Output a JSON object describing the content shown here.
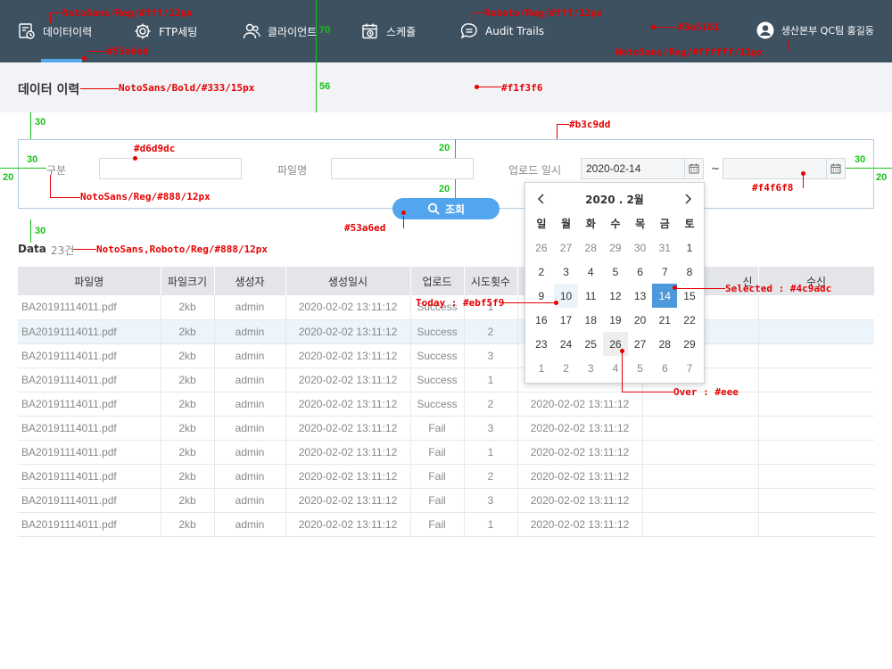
{
  "nav": {
    "items": [
      {
        "label": "데이터이력",
        "icon": "history-document-icon"
      },
      {
        "label": "FTP세팅",
        "icon": "gear-icon"
      },
      {
        "label": "클라이언트",
        "icon": "users-icon"
      },
      {
        "label": "스케쥴",
        "icon": "calendar-clock-icon"
      },
      {
        "label": "Audit Trails",
        "icon": "chat-list-icon"
      }
    ],
    "user": "생산본부 QC팀 홍길동"
  },
  "page": {
    "title": "데이터 이력"
  },
  "search": {
    "fields": [
      {
        "label": "구분",
        "value": ""
      },
      {
        "label": "파일명",
        "value": ""
      }
    ],
    "date_label": "업로드 일시",
    "date_from": "2020-02-14",
    "date_to": "",
    "date_sep": "~",
    "button": "조회"
  },
  "data": {
    "label": "Data",
    "count": "23건"
  },
  "table": {
    "columns": [
      "파일명",
      "파일크기",
      "생성자",
      "생성일시",
      "업로드",
      "시도횟수",
      "",
      "",
      "수신"
    ],
    "partial_header": "신",
    "rows": [
      [
        "BA20191114011.pdf",
        "2kb",
        "admin",
        "2020-02-02 13:11:12",
        "Success",
        "1",
        "",
        "",
        ""
      ],
      [
        "BA20191114011.pdf",
        "2kb",
        "admin",
        "2020-02-02 13:11:12",
        "Success",
        "2",
        "",
        "",
        ""
      ],
      [
        "BA20191114011.pdf",
        "2kb",
        "admin",
        "2020-02-02 13:11:12",
        "Success",
        "3",
        "",
        "",
        ""
      ],
      [
        "BA20191114011.pdf",
        "2kb",
        "admin",
        "2020-02-02 13:11:12",
        "Success",
        "1",
        "",
        "",
        ""
      ],
      [
        "BA20191114011.pdf",
        "2kb",
        "admin",
        "2020-02-02 13:11:12",
        "Success",
        "2",
        "2020-02-02 13:11:12",
        "",
        ""
      ],
      [
        "BA20191114011.pdf",
        "2kb",
        "admin",
        "2020-02-02 13:11:12",
        "Fail",
        "3",
        "2020-02-02 13:11:12",
        "",
        ""
      ],
      [
        "BA20191114011.pdf",
        "2kb",
        "admin",
        "2020-02-02 13:11:12",
        "Fail",
        "1",
        "2020-02-02 13:11:12",
        "",
        ""
      ],
      [
        "BA20191114011.pdf",
        "2kb",
        "admin",
        "2020-02-02 13:11:12",
        "Fail",
        "2",
        "2020-02-02 13:11:12",
        "",
        ""
      ],
      [
        "BA20191114011.pdf",
        "2kb",
        "admin",
        "2020-02-02 13:11:12",
        "Fail",
        "3",
        "2020-02-02 13:11:12",
        "",
        ""
      ],
      [
        "BA20191114011.pdf",
        "2kb",
        "admin",
        "2020-02-02 13:11:12",
        "Fail",
        "1",
        "2020-02-02 13:11:12",
        "",
        ""
      ]
    ],
    "highlight_row": 1
  },
  "calendar": {
    "title": "2020 . 2월",
    "weekdays": [
      "일",
      "월",
      "화",
      "수",
      "목",
      "금",
      "토"
    ],
    "weeks": [
      [
        [
          "26",
          "muted"
        ],
        [
          "27",
          "muted"
        ],
        [
          "28",
          "muted"
        ],
        [
          "29",
          "muted"
        ],
        [
          "30",
          "muted"
        ],
        [
          "31",
          "muted"
        ],
        [
          "1",
          ""
        ]
      ],
      [
        [
          "2",
          ""
        ],
        [
          "3",
          ""
        ],
        [
          "4",
          ""
        ],
        [
          "5",
          ""
        ],
        [
          "6",
          ""
        ],
        [
          "7",
          ""
        ],
        [
          "8",
          ""
        ]
      ],
      [
        [
          "9",
          ""
        ],
        [
          "10",
          "today"
        ],
        [
          "11",
          ""
        ],
        [
          "12",
          ""
        ],
        [
          "13",
          ""
        ],
        [
          "14",
          "sel"
        ],
        [
          "15",
          ""
        ]
      ],
      [
        [
          "16",
          ""
        ],
        [
          "17",
          ""
        ],
        [
          "18",
          ""
        ],
        [
          "19",
          ""
        ],
        [
          "20",
          ""
        ],
        [
          "21",
          ""
        ],
        [
          "22",
          ""
        ]
      ],
      [
        [
          "23",
          ""
        ],
        [
          "24",
          ""
        ],
        [
          "25",
          ""
        ],
        [
          "26",
          "over"
        ],
        [
          "27",
          ""
        ],
        [
          "28",
          ""
        ],
        [
          "29",
          ""
        ]
      ],
      [
        [
          "1",
          "muted"
        ],
        [
          "2",
          "muted"
        ],
        [
          "3",
          "muted"
        ],
        [
          "4",
          "muted"
        ],
        [
          "5",
          "muted"
        ],
        [
          "6",
          "muted"
        ],
        [
          "7",
          "muted"
        ]
      ]
    ]
  },
  "annotations": {
    "nav_font": "NotoSans/Reg/#fff/12px",
    "nav_font_en": "Roboto/Reg/#fff/12px",
    "nav_bg": "#3e5161",
    "user_font": "NotoSans/Reg/#ffffff/11px",
    "active_bar": "#53a6ed",
    "title_font": "NotoSans/Bold/#333/15px",
    "title_bg": "#f1f3f6",
    "box_border": "#b3c9dd",
    "input_border": "#d6d9dc",
    "label_font": "NotoSans/Reg/#888/12px",
    "date_bg": "#f4f6f8",
    "button_bg": "#53a6ed",
    "count_font": "NotoSans,Roboto/Reg/#888/12px",
    "today": "Today : #ebf5f9",
    "selected": "Selected : #4c9adc",
    "over": "Over : #eee",
    "g70": "70",
    "g56": "56",
    "g30a": "30",
    "g20a": "20",
    "g30b": "30",
    "g20b": "20",
    "g30c": "30",
    "g20c": "20",
    "g30d": "30",
    "g20d": "20",
    "g30e": "30"
  },
  "colors": {
    "nav_bg": "#3e5161",
    "accent": "#53a6ed",
    "selected": "#4c9adc",
    "today": "#ebf5f9",
    "over": "#eeeeee"
  }
}
